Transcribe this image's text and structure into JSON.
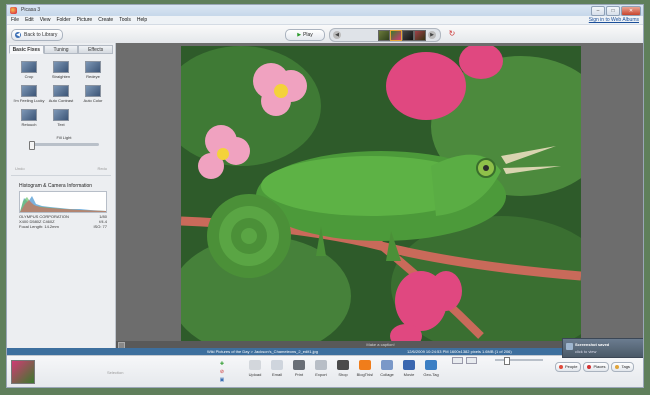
{
  "window": {
    "title": "Picasa 3",
    "sign_in": "Sign in to Web Albums"
  },
  "menu": [
    "File",
    "Edit",
    "View",
    "Folder",
    "Picture",
    "Create",
    "Tools",
    "Help"
  ],
  "toolbar": {
    "back_label": "Back to Library",
    "play_label": "Play",
    "strip_prev": "◀",
    "strip_next": "▶"
  },
  "sidebar": {
    "tabs": [
      {
        "label": "Basic Fixes",
        "active": true
      },
      {
        "label": "Tuning",
        "active": false
      },
      {
        "label": "Effects",
        "active": false
      }
    ],
    "tools": [
      {
        "label": "Crop"
      },
      {
        "label": "Straighten"
      },
      {
        "label": "Redeye"
      },
      {
        "label": "I'm Feeling Lucky"
      },
      {
        "label": "Auto Contrast"
      },
      {
        "label": "Auto Color"
      },
      {
        "label": "Retouch"
      },
      {
        "label": "Text"
      }
    ],
    "fill_light": {
      "label": "Fill Light",
      "value": 0.0
    },
    "undo_label": "Undo",
    "redo_label": "Redo",
    "histogram_title": "Histogram & Camera Information",
    "camera": [
      {
        "key": "OLYMPUS CORPORATION",
        "value": "1/80"
      },
      {
        "key": "X400 D580Z C460Z",
        "value": "f/4.4"
      },
      {
        "key": "Focal Length: 14.2mm",
        "value": "ISO: 77"
      }
    ]
  },
  "viewer": {
    "caption_placeholder": "Make a caption!"
  },
  "infobar": {
    "filename": "Wiki Pictures of the Day > Jackson's_Chameleons_2_edit1.jpg",
    "details": "12/6/2009   10:24:53 PM   1600x1382 pixels   1.6MB   (1 of 206)"
  },
  "tray": {
    "selection_label": "Selection"
  },
  "actions": [
    {
      "label": "Upload",
      "color": "#d3d7dc"
    },
    {
      "label": "Email",
      "color": "#cfd5dd"
    },
    {
      "label": "Print",
      "color": "#6a6f77"
    },
    {
      "label": "Export",
      "color": "#b8bec6"
    },
    {
      "label": "Shop",
      "color": "#4b4b4b"
    },
    {
      "label": "BlogThis!",
      "color": "#f07d1b"
    },
    {
      "label": "Collage",
      "color": "#7a98c8"
    },
    {
      "label": "Movie",
      "color": "#3a67b0"
    },
    {
      "label": "Geo-Tag",
      "color": "#3c7fc4"
    }
  ],
  "pills": [
    {
      "label": "People",
      "color": "#e04b3b"
    },
    {
      "label": "Places",
      "color": "#d43131"
    },
    {
      "label": "Tags",
      "color": "#e0a43a"
    }
  ],
  "notification": {
    "title": "Screenshot saved",
    "subtitle": "click to view"
  },
  "zoom": {
    "level": 0.2
  },
  "colors": {
    "infobar": "#3d6f9e",
    "accent": "#3b6fb5"
  }
}
